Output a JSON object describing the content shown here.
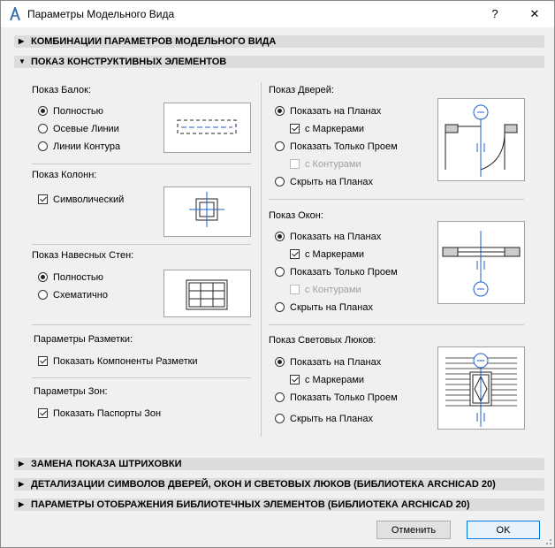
{
  "window": {
    "title": "Параметры Модельного Вида",
    "help_label": "?",
    "close_label": "✕"
  },
  "sections": {
    "combos": "КОМБИНАЦИИ ПАРАМЕТРОВ МОДЕЛЬНОГО ВИДА",
    "construct": "ПОКАЗ КОНСТРУКТИВНЫХ ЭЛЕМЕНТОВ",
    "hatch": "ЗАМЕНА ПОКАЗА ШТРИХОВКИ",
    "detail": "ДЕТАЛИЗАЦИИ СИМВОЛОВ ДВЕРЕЙ, ОКОН И СВЕТОВЫХ ЛЮКОВ (БИБЛИОТЕКА ARCHICAD 20)",
    "library": "ПАРАМЕТРЫ ОТОБРАЖЕНИЯ БИБЛИОТЕЧНЫХ ЭЛЕМЕНТОВ (БИБЛИОТЕКА ARCHICAD 20)"
  },
  "beams": {
    "title": "Показ Балок:",
    "full": "Полностью",
    "axis": "Осевые Линии",
    "contour": "Линии Контура"
  },
  "columns": {
    "title": "Показ Колонн:",
    "symbolic": "Символический"
  },
  "curtain": {
    "title": "Показ Навесных Стен:",
    "full": "Полностью",
    "schematic": "Схематично"
  },
  "markup": {
    "title": "Параметры Разметки:",
    "show": "Показать Компоненты Разметки"
  },
  "zones": {
    "title": "Параметры Зон:",
    "show": "Показать Паспорты Зон"
  },
  "doors": {
    "title": "Показ Дверей:",
    "on_plans": "Показать на Планах",
    "markers": "с Маркерами",
    "opening_only": "Показать Только Проем",
    "contours": "с Контурами",
    "hide": "Скрыть на Планах"
  },
  "windows": {
    "title": "Показ Окон:",
    "on_plans": "Показать на Планах",
    "markers": "с Маркерами",
    "opening_only": "Показать Только Проем",
    "contours": "с Контурами",
    "hide": "Скрыть на Планах"
  },
  "skylights": {
    "title": "Показ Световых Люков:",
    "on_plans": "Показать на Планах",
    "markers": "с Маркерами",
    "opening_only": "Показать Только Проем",
    "hide": "Скрыть на Планах"
  },
  "buttons": {
    "cancel": "Отменить",
    "ok": "OK"
  },
  "colors": {
    "accent": "#0078d7",
    "marker_blue": "#1f5fd0"
  }
}
